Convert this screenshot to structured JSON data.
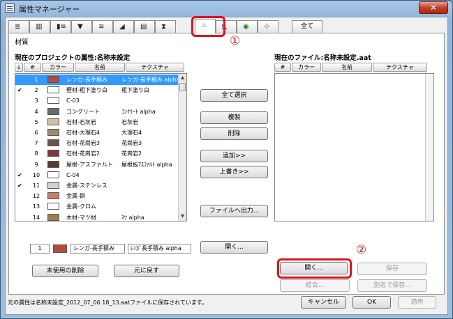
{
  "window": {
    "title": "属性マネージャー",
    "close_label": "✕"
  },
  "tabs": {
    "icons": [
      "layer-tab-icon",
      "pen-tab-icon",
      "line-type-tab-icon",
      "fill-tab-icon",
      "composite-tab-icon",
      "profile-tab-icon",
      "zone-tab-icon",
      "city-tab-icon",
      "hourglass-tab-icon",
      "material-tab-icon",
      "surface-tab-icon",
      "globe-tab-icon",
      "fan-tab-icon"
    ],
    "all_label": "全て"
  },
  "section_title": "材質",
  "markers": {
    "one": "①",
    "two": "②"
  },
  "left_panel": {
    "title": "現在のプロジェクトの属性:名称未設定",
    "headers": {
      "sort_arrow": "↓",
      "index": "#",
      "color": "カラー",
      "name": "名前",
      "texture": "テクスチャ"
    },
    "rows": [
      {
        "check": "",
        "index": "1",
        "color": "#b74a3c",
        "name": "レンガ-長手積み",
        "texture": "レンガ-長手積み alpha",
        "selected": true
      },
      {
        "check": "✔",
        "index": "2",
        "color": "#ffffff",
        "name": "壁材-粗下塗り白",
        "texture": "粗下塗り白",
        "selected": false
      },
      {
        "check": "",
        "index": "3",
        "color": "#ffffff",
        "name": "C-03",
        "texture": "",
        "selected": false
      },
      {
        "check": "",
        "index": "4",
        "color": "#63705f",
        "name": "コンクリート",
        "texture": "ｺﾝｸﾘｰﾄ alpha",
        "selected": false
      },
      {
        "check": "",
        "index": "5",
        "color": "#cfbfa7",
        "name": "石材-石灰岩",
        "texture": "石灰岩",
        "selected": false
      },
      {
        "check": "",
        "index": "6",
        "color": "#9a8a6a",
        "name": "石材-大理石4",
        "texture": "大理石4",
        "selected": false
      },
      {
        "check": "",
        "index": "7",
        "color": "#6b5548",
        "name": "石材-花崗岩3",
        "texture": "花崗岩3",
        "selected": false
      },
      {
        "check": "",
        "index": "8",
        "color": "#7a3a3c",
        "name": "石材-花崗岩2",
        "texture": "花崗岩2",
        "selected": false
      },
      {
        "check": "",
        "index": "9",
        "color": "#5c3a34",
        "name": "屋根-アスファルト",
        "texture": "屋根板ｱｽﾌｧﾙﾄ alpha",
        "selected": false
      },
      {
        "check": "✔",
        "index": "10",
        "color": "#ffffff",
        "name": "C-04",
        "texture": "",
        "selected": false
      },
      {
        "check": "✔",
        "index": "11",
        "color": "#d2d2d2",
        "name": "金属-ステンレス",
        "texture": "",
        "selected": false
      },
      {
        "check": "",
        "index": "12",
        "color": "#c77f6a",
        "name": "金属-銅",
        "texture": "",
        "selected": false
      },
      {
        "check": "",
        "index": "13",
        "color": "#ffffff",
        "name": "金属-クロム",
        "texture": "",
        "selected": false
      },
      {
        "check": "",
        "index": "14",
        "color": "#a07a50",
        "name": "木材-マツ材",
        "texture": "ﾏﾂ alpha",
        "selected": false
      }
    ],
    "edit": {
      "index": "1",
      "color": "#b74a3c",
      "name": "レンガ-長手積み",
      "texture": "ﾚﾝｶﾞ長手積み alpha"
    },
    "delete_unused": "未使用の削除",
    "undo": "元に戻す"
  },
  "middle_buttons": {
    "select_all": "全て選択",
    "duplicate": "複製",
    "delete": "削除",
    "append": "追加>>",
    "overwrite": "上書き>>",
    "export": "ファイルへ出力...",
    "open_small": "開く..."
  },
  "right_panel": {
    "title": "現在のファイル:名称未設定.aat",
    "headers": {
      "index": "#",
      "color": "カラー",
      "name": "名前",
      "texture": "テクスチャ"
    },
    "open": "開く...",
    "save": "保存",
    "merge": "結合...",
    "save_as": "別名で保存..."
  },
  "footer": {
    "status": "元の属性は名称未設定_2012_07_06 18_13.aatファイルに保存されています。",
    "cancel": "キャンセル",
    "ok": "OK",
    "apply": "適用"
  }
}
